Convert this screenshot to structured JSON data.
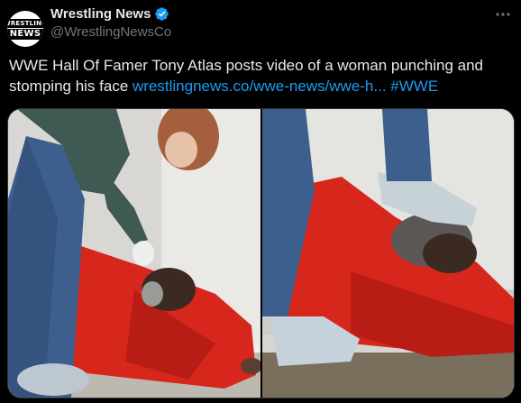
{
  "account": {
    "display_name": "Wrestling News",
    "handle": "@WrestlingNewsCo",
    "avatar_line1": "WRESTLING",
    "avatar_line2": "NEWS",
    "verified_color": "#1d9bf0"
  },
  "tweet": {
    "text": "WWE Hall Of Famer Tony Atlas posts video of a woman punching and stomping his face ",
    "link": "wrestlingnews.co/wwe-news/wwe-h...",
    "hashtag": "#WWE"
  },
  "media": {
    "panels": [
      {
        "label": "woman-punching-man-image"
      },
      {
        "label": "woman-stomping-man-image"
      }
    ]
  },
  "icons": {
    "verified": "verified-badge-icon",
    "more": "more-options-icon"
  }
}
